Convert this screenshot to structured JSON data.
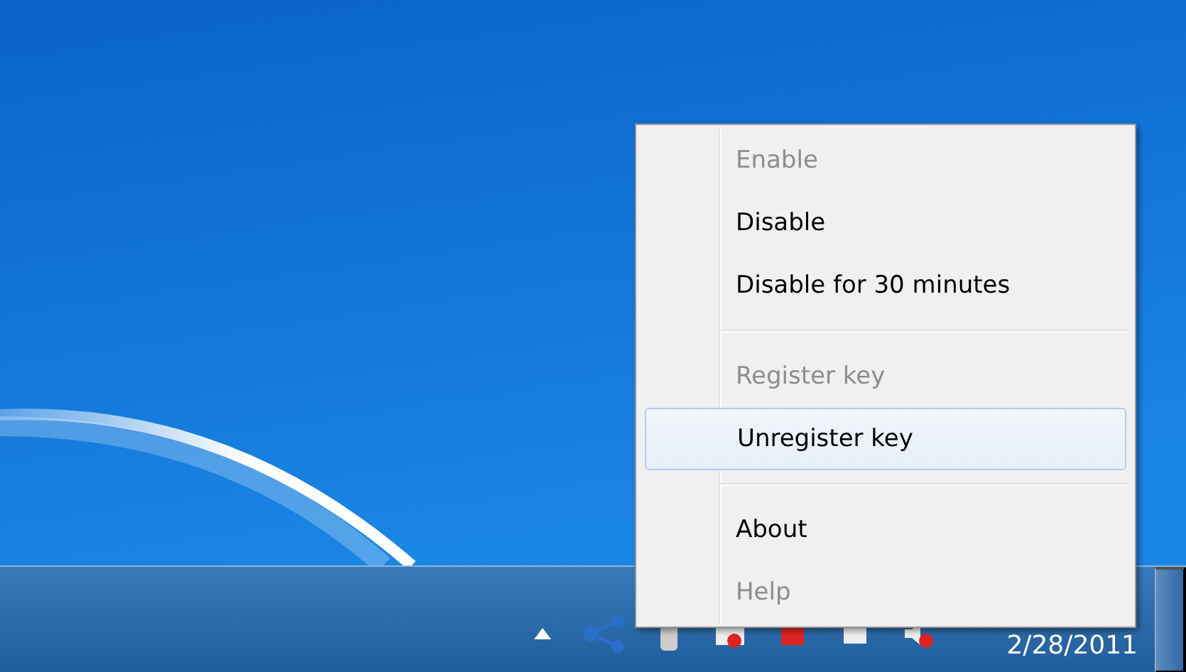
{
  "context_menu": {
    "items": [
      {
        "kind": "item",
        "label": "Enable",
        "disabled": true,
        "selected": false
      },
      {
        "kind": "item",
        "label": "Disable",
        "disabled": false,
        "selected": false
      },
      {
        "kind": "item",
        "label": "Disable for 30 minutes",
        "disabled": false,
        "selected": false
      },
      {
        "kind": "separator"
      },
      {
        "kind": "item",
        "label": "Register key",
        "disabled": true,
        "selected": false
      },
      {
        "kind": "item",
        "label": "Unregister key",
        "disabled": false,
        "selected": true
      },
      {
        "kind": "separator"
      },
      {
        "kind": "item",
        "label": "About",
        "disabled": false,
        "selected": false
      },
      {
        "kind": "item",
        "label": "Help",
        "disabled": true,
        "selected": false
      }
    ]
  },
  "taskbar": {
    "clock": {
      "date": "2/28/2011"
    }
  }
}
